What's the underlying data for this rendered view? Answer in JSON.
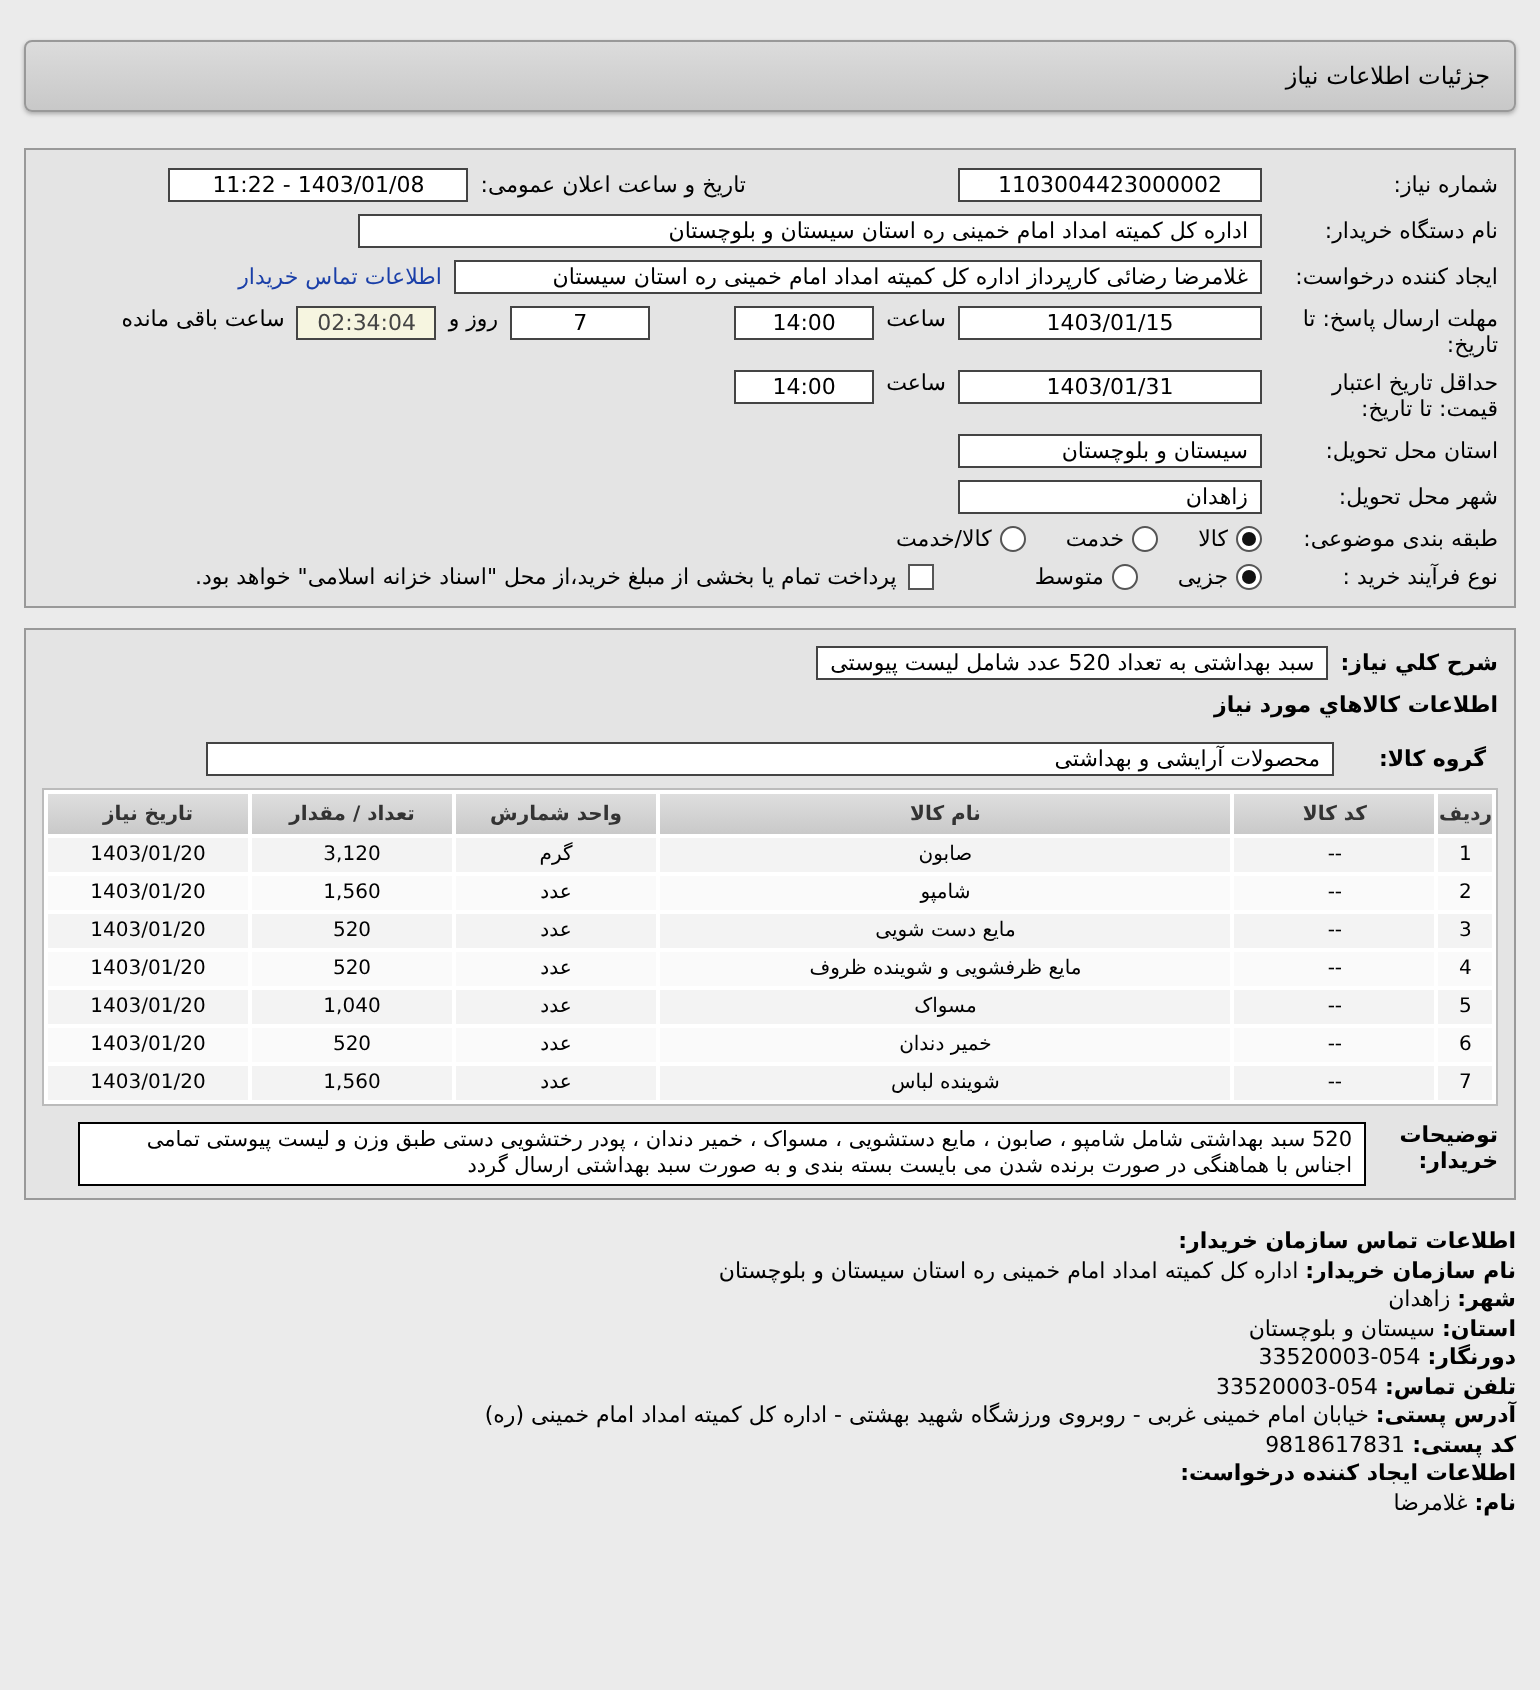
{
  "page_title": "جزئیات اطلاعات نیاز",
  "need_info": {
    "need_number": {
      "label": "شماره نیاز:",
      "value": "1103004423000002"
    },
    "announce": {
      "label": "تاریخ و ساعت اعلان عمومی:",
      "value": "1403/01/08 - 11:22"
    },
    "buyer_org": {
      "label": "نام دستگاه خریدار:",
      "value": "اداره کل کمیته امداد امام خمینی  ره  استان سیستان و بلوچستان"
    },
    "requester": {
      "label": "ایجاد کننده درخواست:",
      "value": "غلامرضا رضائی کارپرداز اداره کل کمیته امداد امام خمینی  ره  استان سیستان",
      "link": "اطلاعات تماس خریدار"
    },
    "deadline": {
      "label": "مهلت ارسال پاسخ: تا تاریخ:",
      "date": "1403/01/15",
      "time_label": "ساعت",
      "time": "14:00",
      "days": "7",
      "days_label": "روز و",
      "remaining": "02:34:04",
      "remaining_label": "ساعت باقی مانده"
    },
    "validity": {
      "label": "حداقل تاریخ اعتبار قیمت: تا تاریخ:",
      "date": "1403/01/31",
      "time_label": "ساعت",
      "time": "14:00"
    },
    "province": {
      "label": "استان محل تحویل:",
      "value": "سیستان و بلوچستان"
    },
    "city": {
      "label": "شهر محل تحویل:",
      "value": "زاهدان"
    },
    "category": {
      "label": "طبقه بندی موضوعی:",
      "options": [
        {
          "label": "کالا",
          "selected": true
        },
        {
          "label": "خدمت",
          "selected": false
        },
        {
          "label": "کالا/خدمت",
          "selected": false
        }
      ]
    },
    "process": {
      "label": "نوع فرآیند خرید :",
      "options": [
        {
          "label": "جزیی",
          "selected": true
        },
        {
          "label": "متوسط",
          "selected": false
        }
      ],
      "payment": {
        "checked": false,
        "text": "پرداخت تمام یا بخشی از مبلغ خرید،از محل \"اسناد خزانه اسلامی\" خواهد بود."
      }
    }
  },
  "items": {
    "summary": {
      "label": "شرح کلي نياز:",
      "value": "سبد بهداشتی به تعداد 520 عدد شامل لیست پیوستی"
    },
    "heading": "اطلاعات کالاهاي مورد نياز",
    "group": {
      "label": "گروه کالا:",
      "value": "محصولات آرایشی و بهداشتی"
    },
    "table": {
      "columns": [
        "ردیف",
        "کد کالا",
        "نام کالا",
        "واحد شمارش",
        "تعداد / مقدار",
        "تاریخ نیاز"
      ],
      "rows": [
        [
          "1",
          "--",
          "صابون",
          "گرم",
          "3,120",
          "1403/01/20"
        ],
        [
          "2",
          "--",
          "شامپو",
          "عدد",
          "1,560",
          "1403/01/20"
        ],
        [
          "3",
          "--",
          "مایع دست شویی",
          "عدد",
          "520",
          "1403/01/20"
        ],
        [
          "4",
          "--",
          "مایع ظرفشویی و شوینده ظروف",
          "عدد",
          "520",
          "1403/01/20"
        ],
        [
          "5",
          "--",
          "مسواک",
          "عدد",
          "1,040",
          "1403/01/20"
        ],
        [
          "6",
          "--",
          "خمیر دندان",
          "عدد",
          "520",
          "1403/01/20"
        ],
        [
          "7",
          "--",
          "شوینده لباس",
          "عدد",
          "1,560",
          "1403/01/20"
        ]
      ]
    },
    "description": {
      "label": "توضیحات خریدار:",
      "value": "520 سبد بهداشتی شامل شامپو ، صابون ، مایع دستشویی ، مسواک ، خمیر دندان ، پودر رختشویی دستی طبق وزن و لیست پیوستی تمامی اجناس با هماهنگی در صورت برنده شدن می بایست بسته بندی و به صورت سبد بهداشتی ارسال گردد"
    }
  },
  "contact": {
    "heading": "اطلاعات تماس سازمان خریدار:",
    "lines": [
      {
        "label": "نام سازمان خریدار:",
        "value": "اداره کل کمیته امداد امام خمینی ره استان سیستان و بلوچستان"
      },
      {
        "label": "شهر:",
        "value": "زاهدان"
      },
      {
        "label": "استان:",
        "value": "سیستان و بلوچستان"
      },
      {
        "label": "دورنگار:",
        "value": "054-33520003"
      },
      {
        "label": "تلفن تماس:",
        "value": "054-33520003"
      },
      {
        "label": "آدرس پستی:",
        "value": "خیابان امام خمینی غربی - روبروی ورزشگاه شهید بهشتی - اداره کل کمیته امداد امام خمینی (ره)"
      },
      {
        "label": "کد پستی:",
        "value": "9818617831"
      }
    ],
    "creator_heading": "اطلاعات ایجاد کننده درخواست:",
    "creator_lines": [
      {
        "label": "نام:",
        "value": "غلامرضا"
      }
    ]
  }
}
